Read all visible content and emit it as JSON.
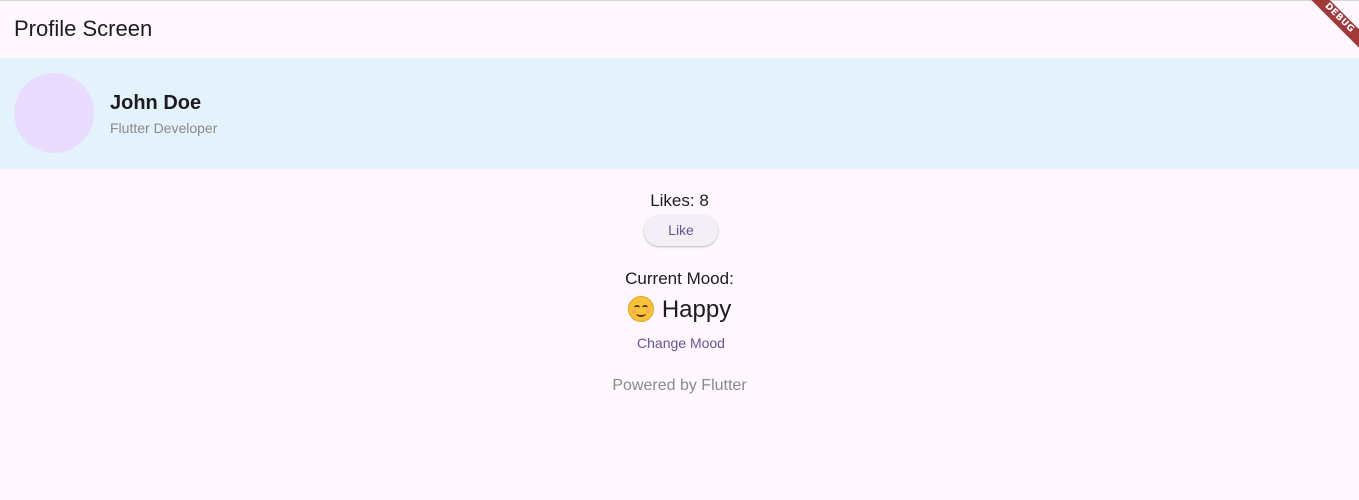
{
  "appbar": {
    "title": "Profile Screen"
  },
  "debug_banner": {
    "label": "DEBUG"
  },
  "profile": {
    "name": "John Doe",
    "role": "Flutter Developer"
  },
  "likes": {
    "text": "Likes: 8",
    "button_label": "Like"
  },
  "mood": {
    "label": "Current Mood:",
    "value": "Happy",
    "icon": "smiling-face-icon",
    "change_label": "Change Mood"
  },
  "footer": {
    "text": "Powered by Flutter"
  },
  "colors": {
    "background": "#fef7ff",
    "header_background": "#e3f2fd",
    "avatar": "#eadcff",
    "accent": "#65558f",
    "debug_banner": "#a03a3a"
  }
}
